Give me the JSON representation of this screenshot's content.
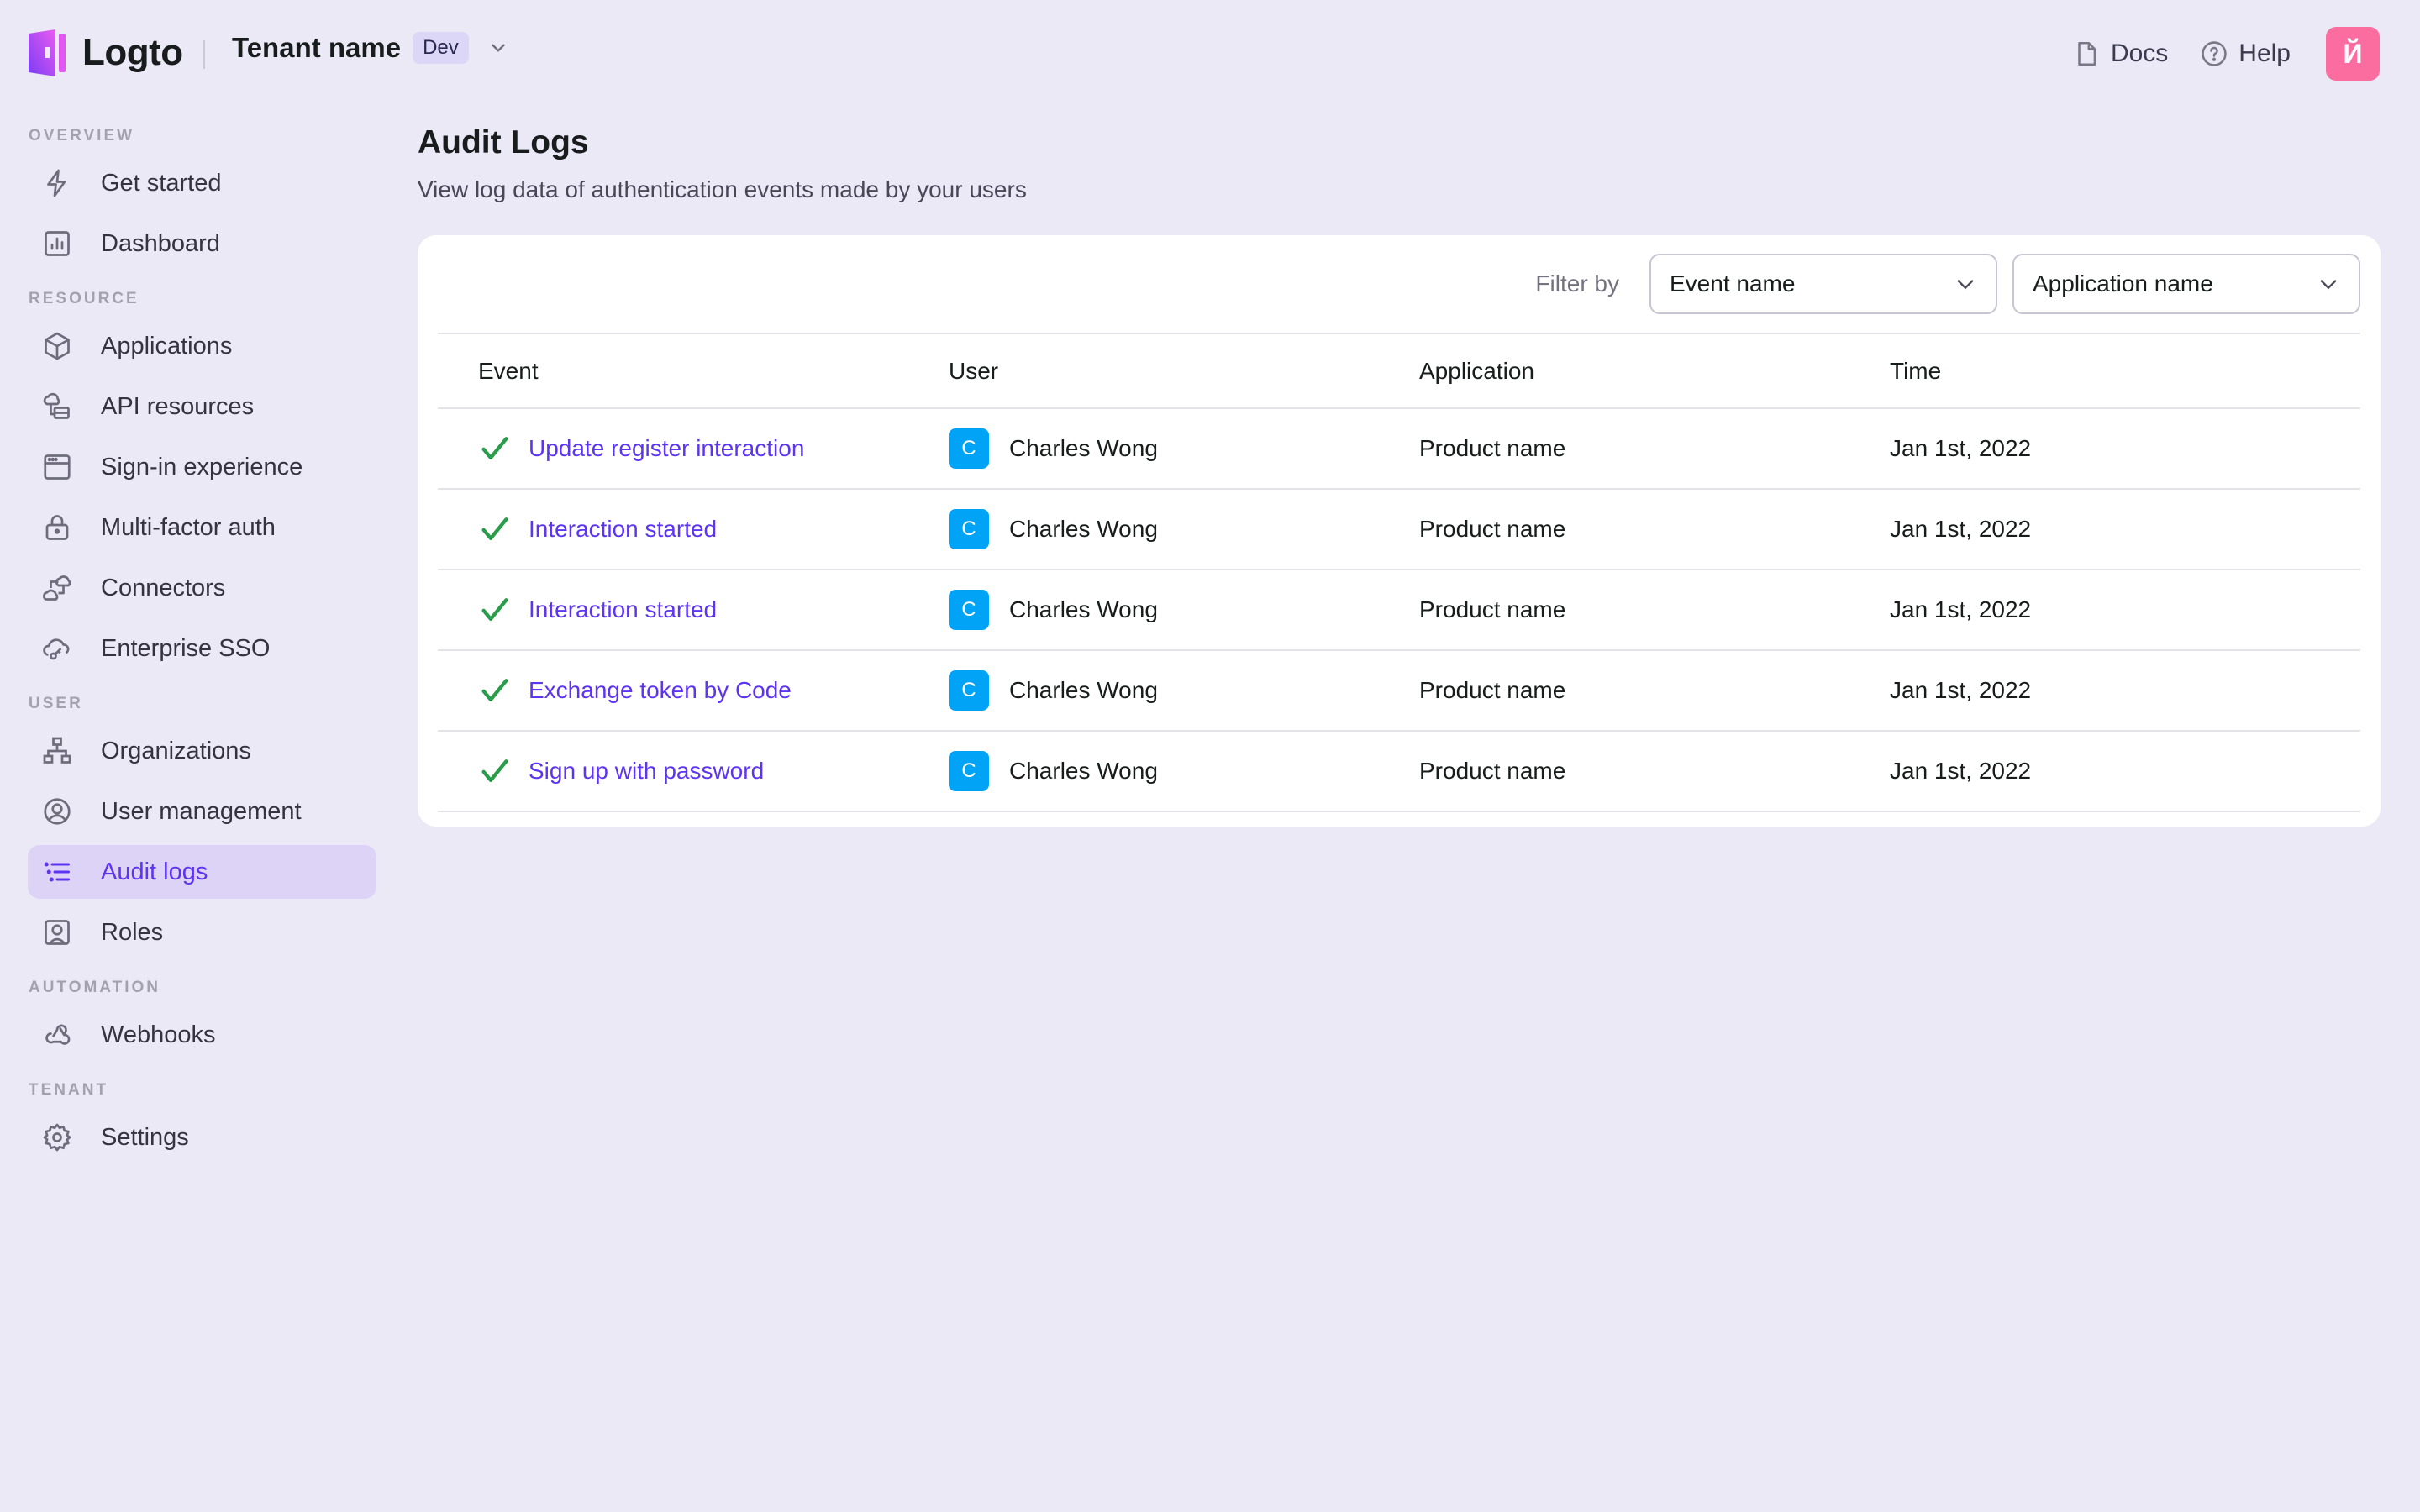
{
  "header": {
    "brand": "Logto",
    "tenant_name": "Tenant name",
    "tenant_tag": "Dev",
    "docs_label": "Docs",
    "help_label": "Help",
    "avatar_letter": "Й",
    "avatar_color": "#fb6d9f"
  },
  "sidebar": {
    "sections": [
      {
        "title": "OVERVIEW",
        "items": [
          {
            "label": "Get started",
            "icon": "lightning-icon"
          },
          {
            "label": "Dashboard",
            "icon": "bar-chart-icon"
          }
        ]
      },
      {
        "title": "RESOURCE",
        "items": [
          {
            "label": "Applications",
            "icon": "cube-icon"
          },
          {
            "label": "API resources",
            "icon": "cloud-server-icon"
          },
          {
            "label": "Sign-in experience",
            "icon": "browser-window-icon"
          },
          {
            "label": "Multi-factor auth",
            "icon": "lock-icon"
          },
          {
            "label": "Connectors",
            "icon": "cloud-connect-icon"
          },
          {
            "label": "Enterprise SSO",
            "icon": "cloud-key-icon"
          }
        ]
      },
      {
        "title": "USER",
        "items": [
          {
            "label": "Organizations",
            "icon": "org-chart-icon"
          },
          {
            "label": "User management",
            "icon": "user-circle-icon"
          },
          {
            "label": "Audit logs",
            "icon": "list-icon",
            "active": true
          },
          {
            "label": "Roles",
            "icon": "user-square-icon"
          }
        ]
      },
      {
        "title": "AUTOMATION",
        "items": [
          {
            "label": "Webhooks",
            "icon": "webhook-icon"
          }
        ]
      },
      {
        "title": "TENANT",
        "items": [
          {
            "label": "Settings",
            "icon": "gear-icon"
          }
        ]
      }
    ]
  },
  "main": {
    "title": "Audit Logs",
    "subtitle": "View log data of authentication events made by your users",
    "filter": {
      "label": "Filter by",
      "event_select": "Event name",
      "app_select": "Application name"
    },
    "table": {
      "columns": [
        "Event",
        "User",
        "Application",
        "Time"
      ],
      "rows": [
        {
          "event": "Update register interaction",
          "user_initial": "C",
          "user": "Charles Wong",
          "application": "Product name",
          "time": "Jan 1st, 2022",
          "status": "success"
        },
        {
          "event": "Interaction started",
          "user_initial": "C",
          "user": "Charles Wong",
          "application": "Product name",
          "time": "Jan 1st, 2022",
          "status": "success"
        },
        {
          "event": "Interaction started",
          "user_initial": "C",
          "user": "Charles Wong",
          "application": "Product name",
          "time": "Jan 1st, 2022",
          "status": "success"
        },
        {
          "event": "Exchange token by Code",
          "user_initial": "C",
          "user": "Charles Wong",
          "application": "Product name",
          "time": "Jan 1st, 2022",
          "status": "success"
        },
        {
          "event": "Sign up with password",
          "user_initial": "C",
          "user": "Charles Wong",
          "application": "Product name",
          "time": "Jan 1st, 2022",
          "status": "success"
        }
      ]
    }
  },
  "colors": {
    "accent": "#5d34f2",
    "success": "#2a9d4a",
    "user_avatar": "#00a3f5",
    "background": "#ebe9f6"
  }
}
